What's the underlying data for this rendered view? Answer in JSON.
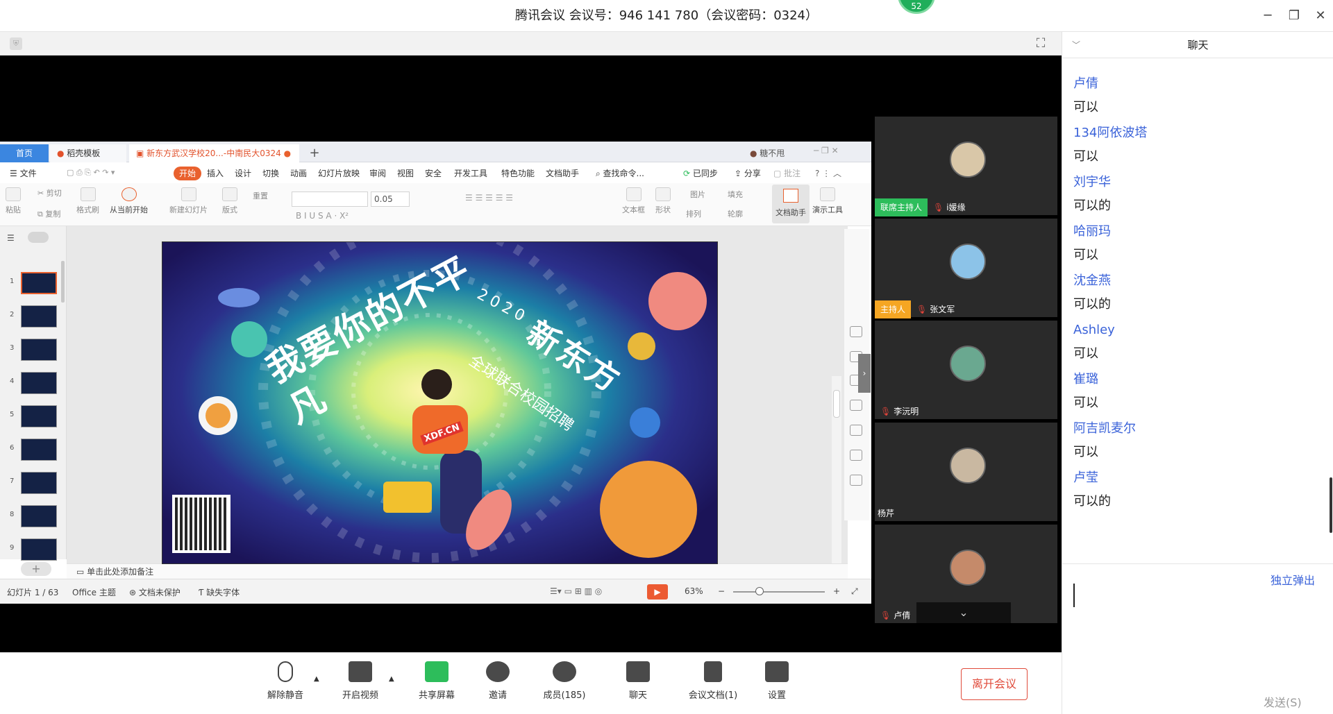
{
  "window": {
    "title": "腾讯会议 会议号：946 141 780（会议密码：0324）",
    "badge": "52",
    "controls": {
      "minimize": "─",
      "restore": "❐",
      "close": "✕"
    }
  },
  "wps": {
    "tabs": {
      "home": "首页",
      "templates": "稻壳模板",
      "document": "新东方武汉学校20...-中南民大0324",
      "user": "糖不甩"
    },
    "menu": {
      "file": "☰ 文件",
      "items": [
        "开始",
        "插入",
        "设计",
        "切换",
        "动画",
        "幻灯片放映",
        "审阅",
        "视图",
        "安全",
        "开发工具",
        "特色功能",
        "文档助手"
      ],
      "search": "查找命令...",
      "sync": "已同步",
      "share": "分享",
      "comment": "批注"
    },
    "ribbon": {
      "paste": "粘贴",
      "cut": "剪切",
      "copy": "复制",
      "format_painter": "格式刷",
      "from_current": "从当前开始",
      "new_slide": "新建幻灯片",
      "layout": "版式",
      "reset": "重置",
      "font_size": "0.05",
      "textbox": "文本框",
      "shape": "形状",
      "arrange": "排列",
      "picture": "图片",
      "fill": "填充",
      "outline": "轮廓",
      "doc_assistant": "文档助手",
      "presentation_tools": "演示工具"
    },
    "slide_numbers": [
      "1",
      "2",
      "3",
      "4",
      "5",
      "6",
      "7",
      "8",
      "9"
    ],
    "slide": {
      "title": "我要你的不平凡",
      "year": "2020",
      "brand": "新东方",
      "subtitle": "全球联合校园招聘",
      "site": "XDF.CN"
    },
    "notes": "单击此处添加备注",
    "status": {
      "slide_counter": "幻灯片 1 / 63",
      "theme": "Office 主题",
      "protection": "文档未保护",
      "missing_font": "缺失字体",
      "zoom": "63%"
    }
  },
  "participants": [
    {
      "role": "联席主持人",
      "role_color": "#2dbd5b",
      "name": "i媛缘",
      "avatar_color": "#d9c7a8"
    },
    {
      "role": "主持人",
      "role_color": "#f5a623",
      "name": "张文军",
      "avatar_color": "#8cc3e8"
    },
    {
      "role": "",
      "role_color": "",
      "name": "李沅明",
      "avatar_color": "#6aa890"
    },
    {
      "role": "",
      "role_color": "",
      "name": "杨芹",
      "avatar_color": "#c9b8a1"
    },
    {
      "role": "",
      "role_color": "",
      "name": "卢倩",
      "avatar_color": "#c58a6a"
    }
  ],
  "toolbar": {
    "unmute": "解除静音",
    "video": "开启视频",
    "share": "共享屏幕",
    "invite": "邀请",
    "members": "成员(185)",
    "chat": "聊天",
    "docs": "会议文档(1)",
    "settings": "设置",
    "leave": "离开会议"
  },
  "chat": {
    "title": "聊天",
    "partial_top": "可以",
    "messages": [
      {
        "sender": "卢倩",
        "text": "可以"
      },
      {
        "sender": "134阿依波塔",
        "text": "可以"
      },
      {
        "sender": "刘宇华",
        "text": "可以的"
      },
      {
        "sender": "哈丽玛",
        "text": "可以"
      },
      {
        "sender": "沈金燕",
        "text": "可以的"
      },
      {
        "sender": "Ashley",
        "text": "可以"
      },
      {
        "sender": "崔璐",
        "text": "可以"
      },
      {
        "sender": "阿吉凯麦尔",
        "text": "可以"
      },
      {
        "sender": "卢莹",
        "text": "可以的"
      }
    ],
    "popout": "独立弹出",
    "send": "发送(S)"
  }
}
